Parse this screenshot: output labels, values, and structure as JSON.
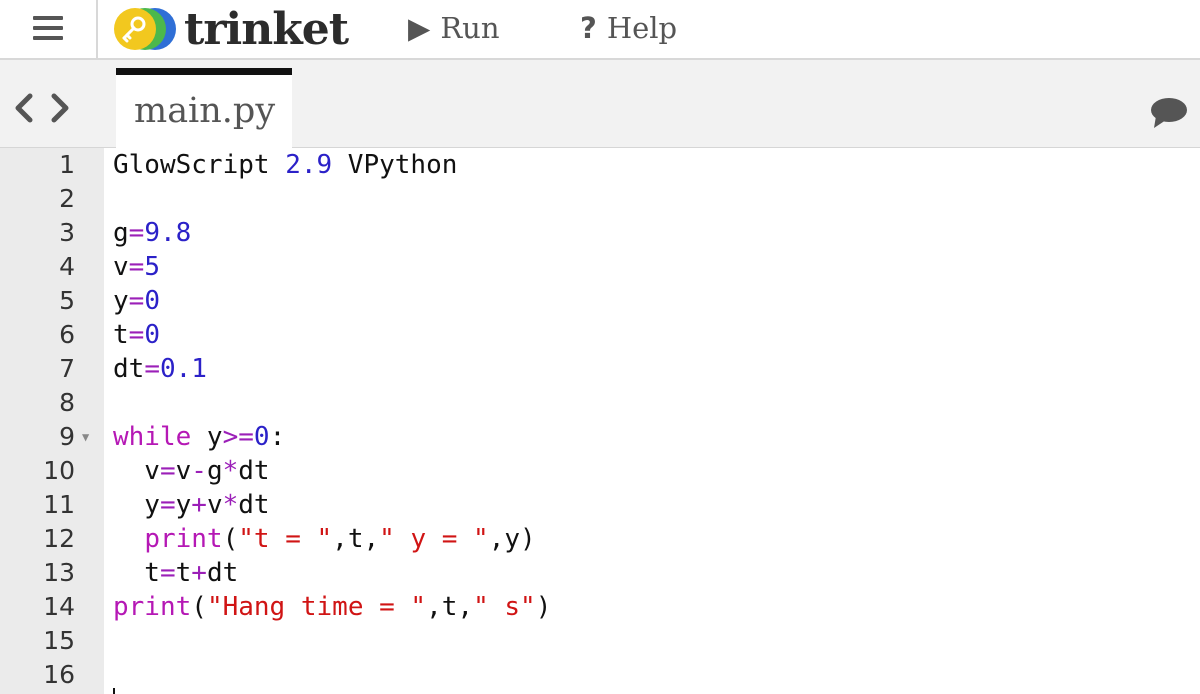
{
  "topbar": {
    "logo_text": "trinket",
    "run_label": "Run",
    "help_label": "Help",
    "run_icon": "play-icon",
    "help_icon": "question-icon",
    "menu_icon": "hamburger-icon"
  },
  "tabs": [
    {
      "label": "main.py"
    }
  ],
  "editor": {
    "lines": [
      {
        "n": "1",
        "tokens": [
          [
            "GlowScript ",
            ""
          ],
          [
            "2.9",
            "num"
          ],
          [
            " VPython",
            ""
          ]
        ]
      },
      {
        "n": "2",
        "tokens": []
      },
      {
        "n": "3",
        "tokens": [
          [
            "g",
            ""
          ],
          [
            "=",
            "op"
          ],
          [
            "9.8",
            "num"
          ]
        ]
      },
      {
        "n": "4",
        "tokens": [
          [
            "v",
            ""
          ],
          [
            "=",
            "op"
          ],
          [
            "5",
            "num"
          ]
        ]
      },
      {
        "n": "5",
        "tokens": [
          [
            "y",
            ""
          ],
          [
            "=",
            "op"
          ],
          [
            "0",
            "num"
          ]
        ]
      },
      {
        "n": "6",
        "tokens": [
          [
            "t",
            ""
          ],
          [
            "=",
            "op"
          ],
          [
            "0",
            "num"
          ]
        ]
      },
      {
        "n": "7",
        "tokens": [
          [
            "dt",
            ""
          ],
          [
            "=",
            "op"
          ],
          [
            "0.1",
            "num"
          ]
        ]
      },
      {
        "n": "8",
        "tokens": []
      },
      {
        "n": "9",
        "fold": true,
        "tokens": [
          [
            "while",
            "kw"
          ],
          [
            " y",
            ""
          ],
          [
            ">=",
            "op"
          ],
          [
            "0",
            "num"
          ],
          [
            ":",
            ""
          ]
        ]
      },
      {
        "n": "10",
        "tokens": [
          [
            "  v",
            ""
          ],
          [
            "=",
            "op"
          ],
          [
            "v",
            ""
          ],
          [
            "-",
            "op"
          ],
          [
            "g",
            ""
          ],
          [
            "*",
            "op"
          ],
          [
            "dt",
            ""
          ]
        ]
      },
      {
        "n": "11",
        "tokens": [
          [
            "  y",
            ""
          ],
          [
            "=",
            "op"
          ],
          [
            "y",
            ""
          ],
          [
            "+",
            "op"
          ],
          [
            "v",
            ""
          ],
          [
            "*",
            "op"
          ],
          [
            "dt",
            ""
          ]
        ]
      },
      {
        "n": "12",
        "tokens": [
          [
            "  ",
            ""
          ],
          [
            "print",
            "fn"
          ],
          [
            "(",
            ""
          ],
          [
            "\"t = \"",
            "str"
          ],
          [
            ",t,",
            ""
          ],
          [
            "\" y = \"",
            "str"
          ],
          [
            ",y)",
            ""
          ]
        ]
      },
      {
        "n": "13",
        "tokens": [
          [
            "  t",
            ""
          ],
          [
            "=",
            "op"
          ],
          [
            "t",
            ""
          ],
          [
            "+",
            "op"
          ],
          [
            "dt",
            ""
          ]
        ]
      },
      {
        "n": "14",
        "tokens": [
          [
            "print",
            "fn"
          ],
          [
            "(",
            ""
          ],
          [
            "\"Hang time = \"",
            "str"
          ],
          [
            ",t,",
            ""
          ],
          [
            "\" s\"",
            "str"
          ],
          [
            ")",
            ""
          ]
        ]
      },
      {
        "n": "15",
        "tokens": []
      },
      {
        "n": "16",
        "tokens": []
      }
    ]
  },
  "colors": {
    "number": "#2b21c8",
    "operator": "#9b1fb8",
    "keyword": "#b518b5",
    "string": "#d01414",
    "tab_indicator": "#111111",
    "gutter": "#ebebeb"
  }
}
